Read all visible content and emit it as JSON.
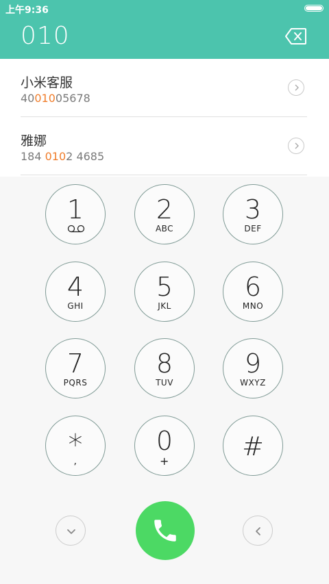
{
  "status_bar": {
    "time": "上午9:36"
  },
  "dialer": {
    "number": "010"
  },
  "contacts": [
    {
      "name": "小米客服",
      "number_before": "40",
      "number_match": "010",
      "number_after": "05678"
    },
    {
      "name": "雅娜",
      "number_before": "184 ",
      "number_match": "010",
      "number_after": "2 4685"
    }
  ],
  "keypad": [
    {
      "digit": "1",
      "letters": ""
    },
    {
      "digit": "2",
      "letters": "ABC"
    },
    {
      "digit": "3",
      "letters": "DEF"
    },
    {
      "digit": "4",
      "letters": "GHI"
    },
    {
      "digit": "5",
      "letters": "JKL"
    },
    {
      "digit": "6",
      "letters": "MNO"
    },
    {
      "digit": "7",
      "letters": "PQRS"
    },
    {
      "digit": "8",
      "letters": "TUV"
    },
    {
      "digit": "9",
      "letters": "WXYZ"
    },
    {
      "digit": "*",
      "letters": ","
    },
    {
      "digit": "0",
      "letters": "+"
    },
    {
      "digit": "#",
      "letters": ""
    }
  ],
  "colors": {
    "header": "#4cc4ad",
    "match_highlight": "#f07d2b",
    "call_button": "#4cd964",
    "key_border": "#7f9a95"
  },
  "icons": {
    "backspace": "backspace-icon",
    "voicemail": "voicemail-icon",
    "detail": "chevron-right-icon",
    "collapse": "chevron-down-icon",
    "back": "chevron-left-icon",
    "call": "phone-icon"
  }
}
